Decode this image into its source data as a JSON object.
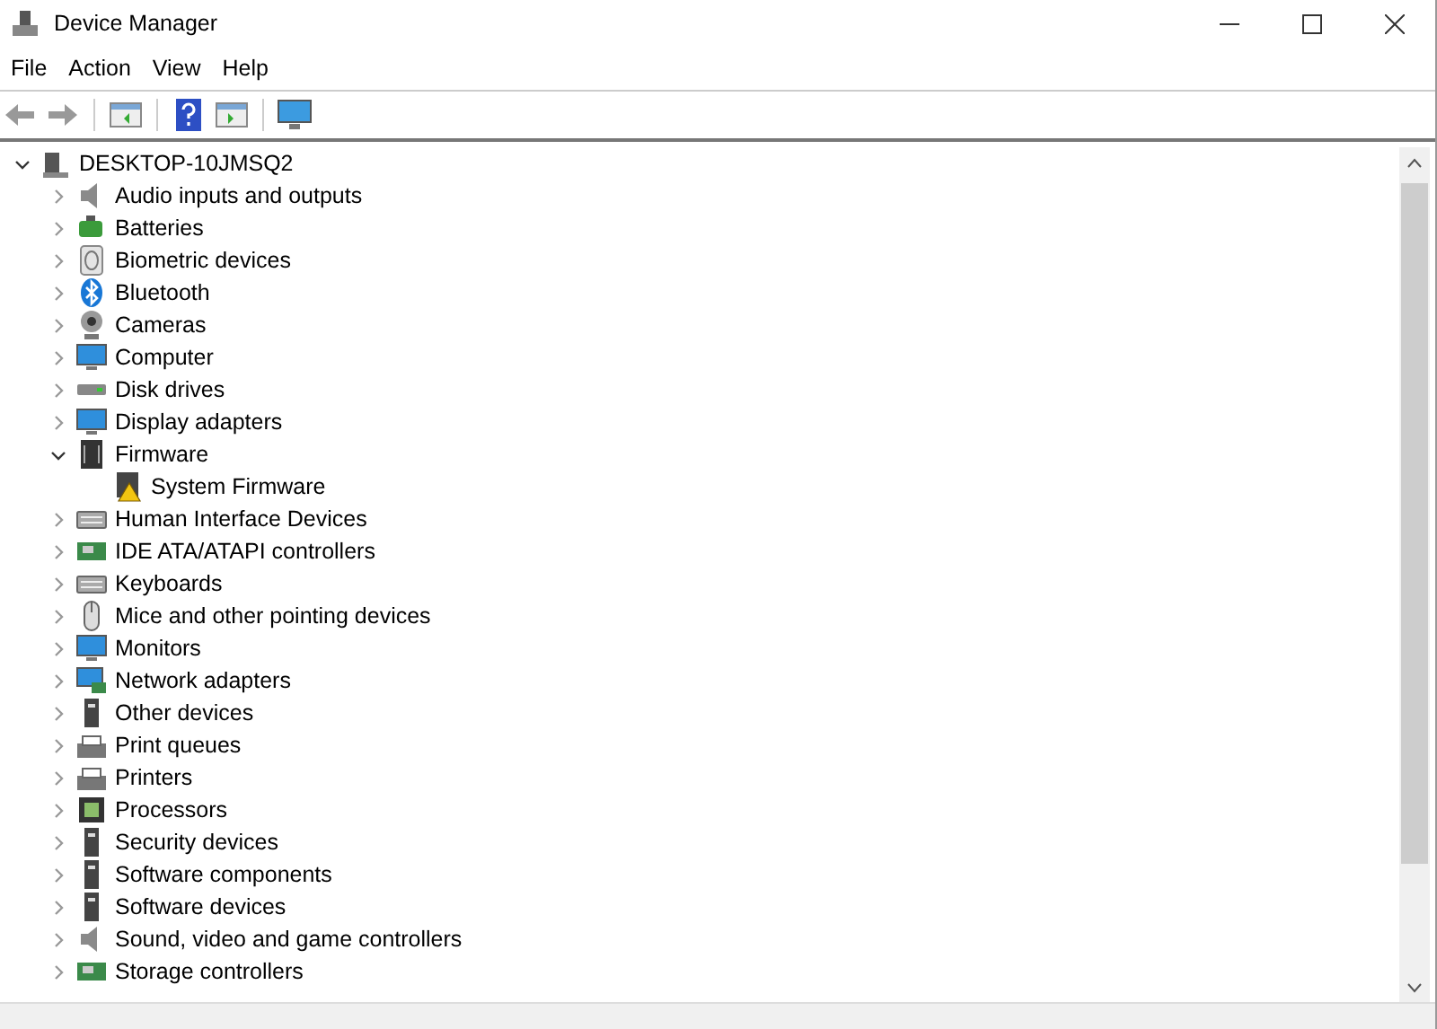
{
  "window": {
    "title": "Device Manager"
  },
  "menu": [
    "File",
    "Action",
    "View",
    "Help"
  ],
  "tree": {
    "label": "DESKTOP-10JMSQ2",
    "expanded": true,
    "children": [
      {
        "label": "Audio inputs and outputs",
        "expanded": false
      },
      {
        "label": "Batteries",
        "expanded": false
      },
      {
        "label": "Biometric devices",
        "expanded": false
      },
      {
        "label": "Bluetooth",
        "expanded": false
      },
      {
        "label": "Cameras",
        "expanded": false
      },
      {
        "label": "Computer",
        "expanded": false
      },
      {
        "label": "Disk drives",
        "expanded": false
      },
      {
        "label": "Display adapters",
        "expanded": false
      },
      {
        "label": "Firmware",
        "expanded": true,
        "children": [
          {
            "label": "System Firmware"
          }
        ]
      },
      {
        "label": "Human Interface Devices",
        "expanded": false
      },
      {
        "label": "IDE ATA/ATAPI controllers",
        "expanded": false
      },
      {
        "label": "Keyboards",
        "expanded": false
      },
      {
        "label": "Mice and other pointing devices",
        "expanded": false
      },
      {
        "label": "Monitors",
        "expanded": false
      },
      {
        "label": "Network adapters",
        "expanded": false
      },
      {
        "label": "Other devices",
        "expanded": false
      },
      {
        "label": "Print queues",
        "expanded": false
      },
      {
        "label": "Printers",
        "expanded": false
      },
      {
        "label": "Processors",
        "expanded": false
      },
      {
        "label": "Security devices",
        "expanded": false
      },
      {
        "label": "Software components",
        "expanded": false
      },
      {
        "label": "Software devices",
        "expanded": false
      },
      {
        "label": "Sound, video and game controllers",
        "expanded": false
      },
      {
        "label": "Storage controllers",
        "expanded": false
      }
    ]
  }
}
